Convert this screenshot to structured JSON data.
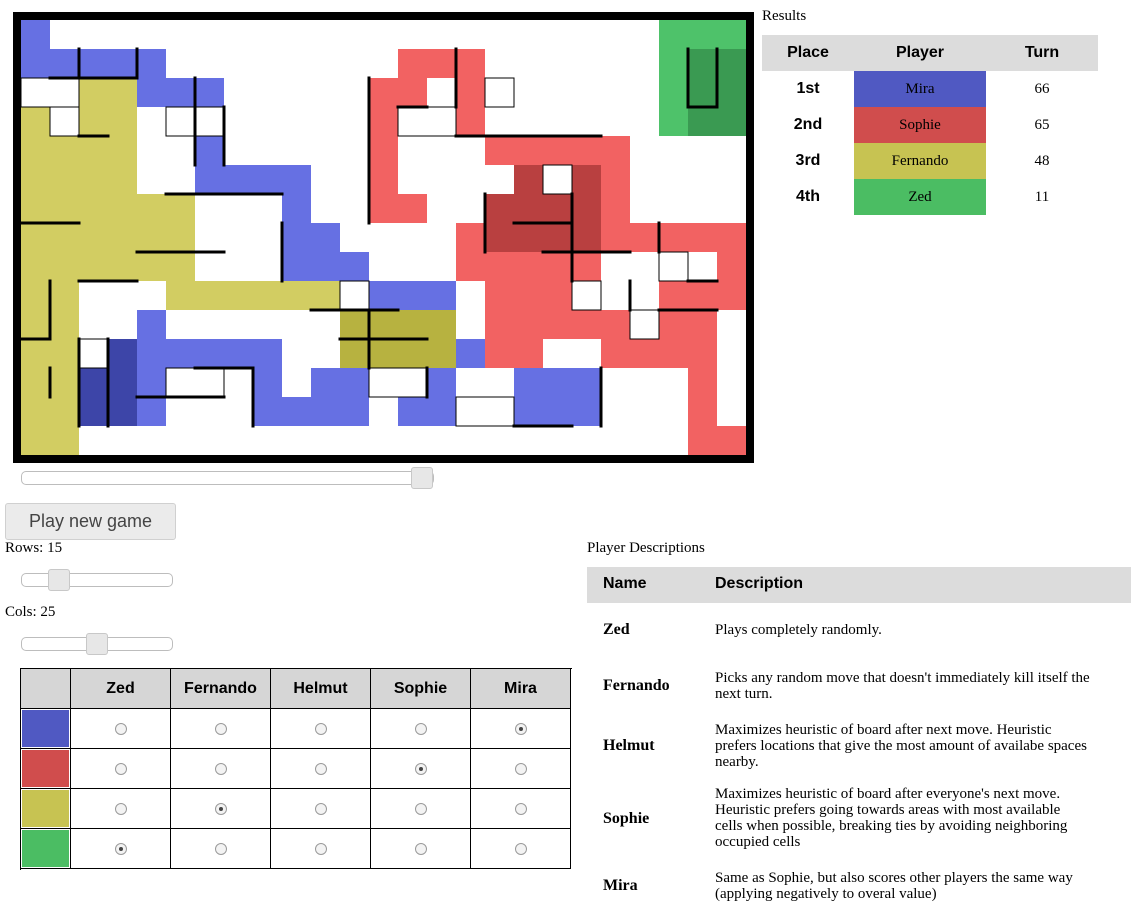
{
  "board": {
    "rows": 15,
    "cols": 25,
    "colors": {
      "blue": "#6670e3",
      "blue_dark": "#3d45a8",
      "red": "#f26262",
      "red_dark": "#b94040",
      "yellow": "#d2cd62",
      "yellow_dark": "#b7b240",
      "green": "#4ec26a",
      "green_dark": "#3a9a52",
      "border": "#000000",
      "empty": "#ffffff"
    }
  },
  "history_slider": {
    "value": 1.0
  },
  "play_button_label": "Play new game",
  "rows_label": "Rows: 15",
  "rows_slider": {
    "value": 15,
    "fraction": 0.26
  },
  "cols_label": "Cols: 25",
  "cols_slider": {
    "value": 25,
    "fraction": 0.51
  },
  "assignment": {
    "players": [
      "Zed",
      "Fernando",
      "Helmut",
      "Sophie",
      "Mira"
    ],
    "rows": [
      {
        "color": "#5059c2",
        "selected": "Mira"
      },
      {
        "color": "#d04d4d",
        "selected": "Sophie"
      },
      {
        "color": "#c7c352",
        "selected": "Fernando"
      },
      {
        "color": "#4bbd63",
        "selected": "Zed"
      }
    ]
  },
  "results": {
    "title": "Results",
    "headers": [
      "Place",
      "Player",
      "Turn"
    ],
    "rows": [
      {
        "place": "1st",
        "player": "Mira",
        "turn": "66",
        "color": "#5059c2"
      },
      {
        "place": "2nd",
        "player": "Sophie",
        "turn": "65",
        "color": "#d04d4d"
      },
      {
        "place": "3rd",
        "player": "Fernando",
        "turn": "48",
        "color": "#c7c352"
      },
      {
        "place": "4th",
        "player": "Zed",
        "turn": "11",
        "color": "#4bbd63"
      }
    ]
  },
  "descriptions": {
    "title": "Player Descriptions",
    "headers": [
      "Name",
      "Description"
    ],
    "rows": [
      {
        "name": "Zed",
        "lines": [
          "Plays completely randomly."
        ]
      },
      {
        "name": "Fernando",
        "lines": [
          "Picks any random move that doesn't immediately kill itself the",
          "next turn."
        ]
      },
      {
        "name": "Helmut",
        "lines": [
          "Maximizes heuristic of board after next move. Heuristic",
          "prefers locations that give the most amount of availabe spaces",
          "nearby."
        ]
      },
      {
        "name": "Sophie",
        "lines": [
          "Maximizes heuristic of board after everyone's next move.",
          "Heuristic prefers going towards areas with most available",
          "cells when possible, breaking ties by avoiding neighboring",
          "occupied cells"
        ]
      },
      {
        "name": "Mira",
        "lines": [
          "Same as Sophie, but also scores other players the same way",
          "(applying negatively to overal value)"
        ]
      }
    ]
  }
}
